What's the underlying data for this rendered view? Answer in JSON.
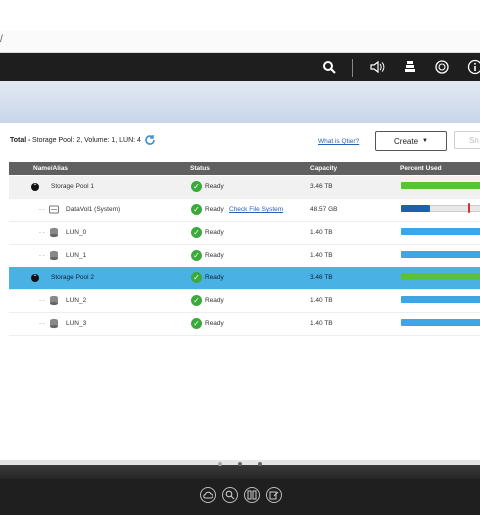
{
  "browser": {
    "url_fragment": "/"
  },
  "toolbar": {
    "icons": [
      "search-icon",
      "speaker-icon",
      "stack-icon",
      "sync-icon",
      "info-icon"
    ]
  },
  "summary": {
    "label": "Total -",
    "text": "Storage Pool: 2, Volume: 1, LUN: 4",
    "qtier_link": "What is Qtier?",
    "create_label": "Create",
    "snap_label": "Sn"
  },
  "table": {
    "headers": {
      "name": "Name/Alias",
      "status": "Status",
      "capacity": "Capacity",
      "percent": "Percent Used"
    },
    "rows": [
      {
        "name": "Storage Pool 1",
        "status": "Ready",
        "extra": "",
        "capacity": "3.46 TB",
        "kind": "pool",
        "usage": 1.0,
        "usage_color": "#5bc236"
      },
      {
        "name": "DataVol1 (System)",
        "status": "Ready",
        "extra": "Check File System",
        "capacity": "48.57 GB",
        "kind": "volume",
        "usage": 0.33,
        "usage_color": "#1f5fae"
      },
      {
        "name": "LUN_0",
        "status": "Ready",
        "extra": "",
        "capacity": "1.40 TB",
        "kind": "lun",
        "usage": 1.0,
        "usage_color": "#3ca6e6"
      },
      {
        "name": "LUN_1",
        "status": "Ready",
        "extra": "",
        "capacity": "1.40 TB",
        "kind": "lun",
        "usage": 1.0,
        "usage_color": "#3ca6e6"
      },
      {
        "name": "Storage Pool 2",
        "status": "Ready",
        "extra": "",
        "capacity": "3.46 TB",
        "kind": "pool-selected",
        "usage": 1.0,
        "usage_color": "#5bc236"
      },
      {
        "name": "LUN_2",
        "status": "Ready",
        "extra": "",
        "capacity": "1.40 TB",
        "kind": "lun",
        "usage": 1.0,
        "usage_color": "#3ca6e6"
      },
      {
        "name": "LUN_3",
        "status": "Ready",
        "extra": "",
        "capacity": "1.40 TB",
        "kind": "lun",
        "usage": 1.0,
        "usage_color": "#3ca6e6"
      }
    ]
  },
  "dock": {
    "icons": [
      "cloud-icon",
      "search-icon",
      "grid-icon",
      "edit-icon"
    ]
  }
}
